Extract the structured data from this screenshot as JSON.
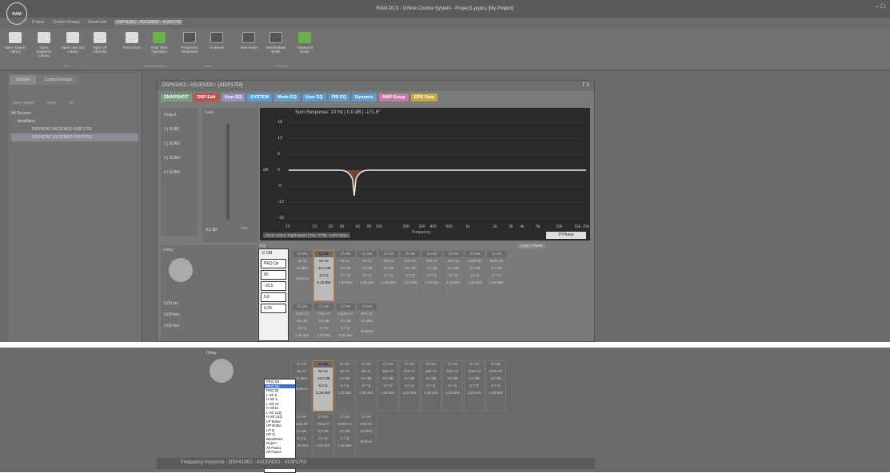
{
  "app": {
    "title": "RAM DCS - Online Control System - Project1.prjdcs [My Project]",
    "logo": "RAM"
  },
  "menu": [
    "Project",
    "Control Groups",
    "Smart Link",
    "DSP410K2 - ASCENDO - 410P1753"
  ],
  "ribbon": [
    {
      "label": "Open System Library",
      "icon": "folder-icon"
    },
    {
      "label": "Open Snapshot Library",
      "icon": "folder-icon"
    },
    {
      "label": "Open User EQ Library",
      "icon": "folder-icon"
    },
    {
      "label": "Open All Libraries",
      "icon": "folder-icon"
    },
    {
      "label": "Force Sync",
      "icon": "sync-icon"
    },
    {
      "label": "Real Time Operation",
      "icon": "online-icon"
    },
    {
      "label": "Frequency Response",
      "icon": "graph-icon"
    },
    {
      "label": "VU Mode",
      "icon": "vu-icon"
    },
    {
      "label": "User Mode",
      "icon": "user-icon"
    },
    {
      "label": "Intermediate Mode",
      "icon": "mode-icon"
    },
    {
      "label": "Advanced Mode",
      "icon": "advanced-icon"
    }
  ],
  "ribbon_groups": [
    "File",
    "Communication",
    "View",
    "Security"
  ],
  "left": {
    "tabs": [
      "Devices",
      "Control Groups"
    ],
    "headers": [
      "Zone / Model",
      "Name",
      "SN"
    ],
    "tree": [
      "All Devices",
      "Amplifiers",
      "DSP410K2    ASCENDO  410P1753",
      "DSP410K2    ASCENDO  410P1753"
    ]
  },
  "panel": {
    "title": "DSP410K2 - ASCENDO - [410P1753]",
    "tabs": [
      {
        "label": "SNAPSHOT",
        "color": "#7aa07a"
      },
      {
        "label": "DSP Edit",
        "color": "#c0504d"
      },
      {
        "label": "User EQ",
        "color": "#9b8fc0"
      },
      {
        "label": "SYSTEM",
        "color": "#5b9bd5"
      },
      {
        "label": "Mode EQ",
        "color": "#5b9bd5"
      },
      {
        "label": "User EQ",
        "color": "#5b9bd5"
      },
      {
        "label": "FIR EQ",
        "color": "#5b9bd5"
      },
      {
        "label": "Dynamic",
        "color": "#5b9bd5"
      },
      {
        "label": "AMP Setup",
        "color": "#c97aa8"
      },
      {
        "label": "EPG Data",
        "color": "#c9a83a"
      }
    ],
    "output_label": "Output",
    "outputs": [
      "1 | SUB1",
      "2 | SUB2",
      "3 | SUB3",
      "4 | SUB4"
    ],
    "gain_label": "Gain",
    "gain_value": "0,0",
    "gain_unit": "dB",
    "trim_label": "Trim",
    "graph_title": "Sum Response: 10 Hz  |  0,0 dB  |  -171,6°",
    "y_ticks": [
      "18",
      "12",
      "6",
      "0",
      "-6",
      "-12",
      "-18"
    ],
    "x_ticks": [
      "10",
      "20",
      "30",
      "40",
      "60",
      "80",
      "100",
      "200",
      "300",
      "400",
      "600",
      "1k",
      "2k",
      "3k",
      "4k",
      "6k",
      "10k",
      "16k",
      "20k"
    ],
    "x_label": "Frequency",
    "y_label": "dB",
    "zoom_hint": "Zoom In/Out: Right button | Pan: CTRL +Left button",
    "phase_button": "0°Phase",
    "delay_label": "Delay",
    "eq_label": "EQ",
    "copy_paste": "Copy / Paste",
    "delay_units": [
      "ms",
      "feet",
      "mm"
    ],
    "delay_value": "0,00",
    "sel_band": {
      "on": "ON",
      "type": "PEQ Qs",
      "freq": "60",
      "gain": "-10,0",
      "q": "5,0",
      "bw": "0,29"
    },
    "eq_bands": [
      {
        "freq": "35 Hz",
        "gain": "24 dB/o",
        "q": "",
        "bw": "Butterw"
      },
      {
        "freq": "60 Hz",
        "gain": "-10,0 dB",
        "q": "5,0 Q",
        "bw": "0,29 BW",
        "active": true
      },
      {
        "freq": "50 Hz",
        "gain": "0,0 dB",
        "q": "0,7 Q",
        "bw": "1,92 BW"
      },
      {
        "freq": "90 Hz",
        "gain": "0,0 dB",
        "q": "0,7 Q",
        "bw": "1,92 BW"
      },
      {
        "freq": "150 Hz",
        "gain": "0,0 dB",
        "q": "0,7 Q",
        "bw": "1,92 BW"
      },
      {
        "freq": "270 Hz",
        "gain": "0,0 dB",
        "q": "0,7 Q",
        "bw": "1,92 BW"
      },
      {
        "freq": "460 Hz",
        "gain": "0,0 dB",
        "q": "0,7 Q",
        "bw": "1,92 BW"
      },
      {
        "freq": "810 Hz",
        "gain": "0,0 dB",
        "q": "0,7 Q",
        "bw": "1,92 BW"
      },
      {
        "freq": "1400 Hz",
        "gain": "0,0 dB",
        "q": "0,7 Q",
        "bw": "1,92 BW"
      },
      {
        "freq": "2430 Hz",
        "gain": "0,0 dB",
        "q": "0,7 Q",
        "bw": "1,92 BW"
      },
      {
        "freq": "4220 Hz",
        "gain": "0,0 dB",
        "q": "0,7 Q",
        "bw": "1,92 BW"
      },
      {
        "freq": "7320 Hz",
        "gain": "0,0 dB",
        "q": "0,7 Q",
        "bw": "1,92 BW"
      },
      {
        "freq": "12680 Hz",
        "gain": "0,0 dB",
        "q": "0,7 Q",
        "bw": "1,92 BW"
      },
      {
        "freq": "500 Hz",
        "gain": "24 dB/o",
        "q": "",
        "bw": "Butterw"
      }
    ]
  },
  "dropdown": [
    "PEQ Qs",
    "PEQ Qs",
    "PEQ Qt",
    "L-Sh 6",
    "H-Sh 6",
    "L-Sh 12",
    "H-Sh12",
    "L-Sh 12Q",
    "H-Sh 12Q",
    "LP Buttw",
    "HP Buttw",
    "LP Q",
    "HP Q",
    "BandPass",
    "Reject",
    "All Pass1",
    "All Pass2"
  ],
  "freqresp_title": "Frequency response - DSP410K2 - ASCENDO - 410P1753"
}
